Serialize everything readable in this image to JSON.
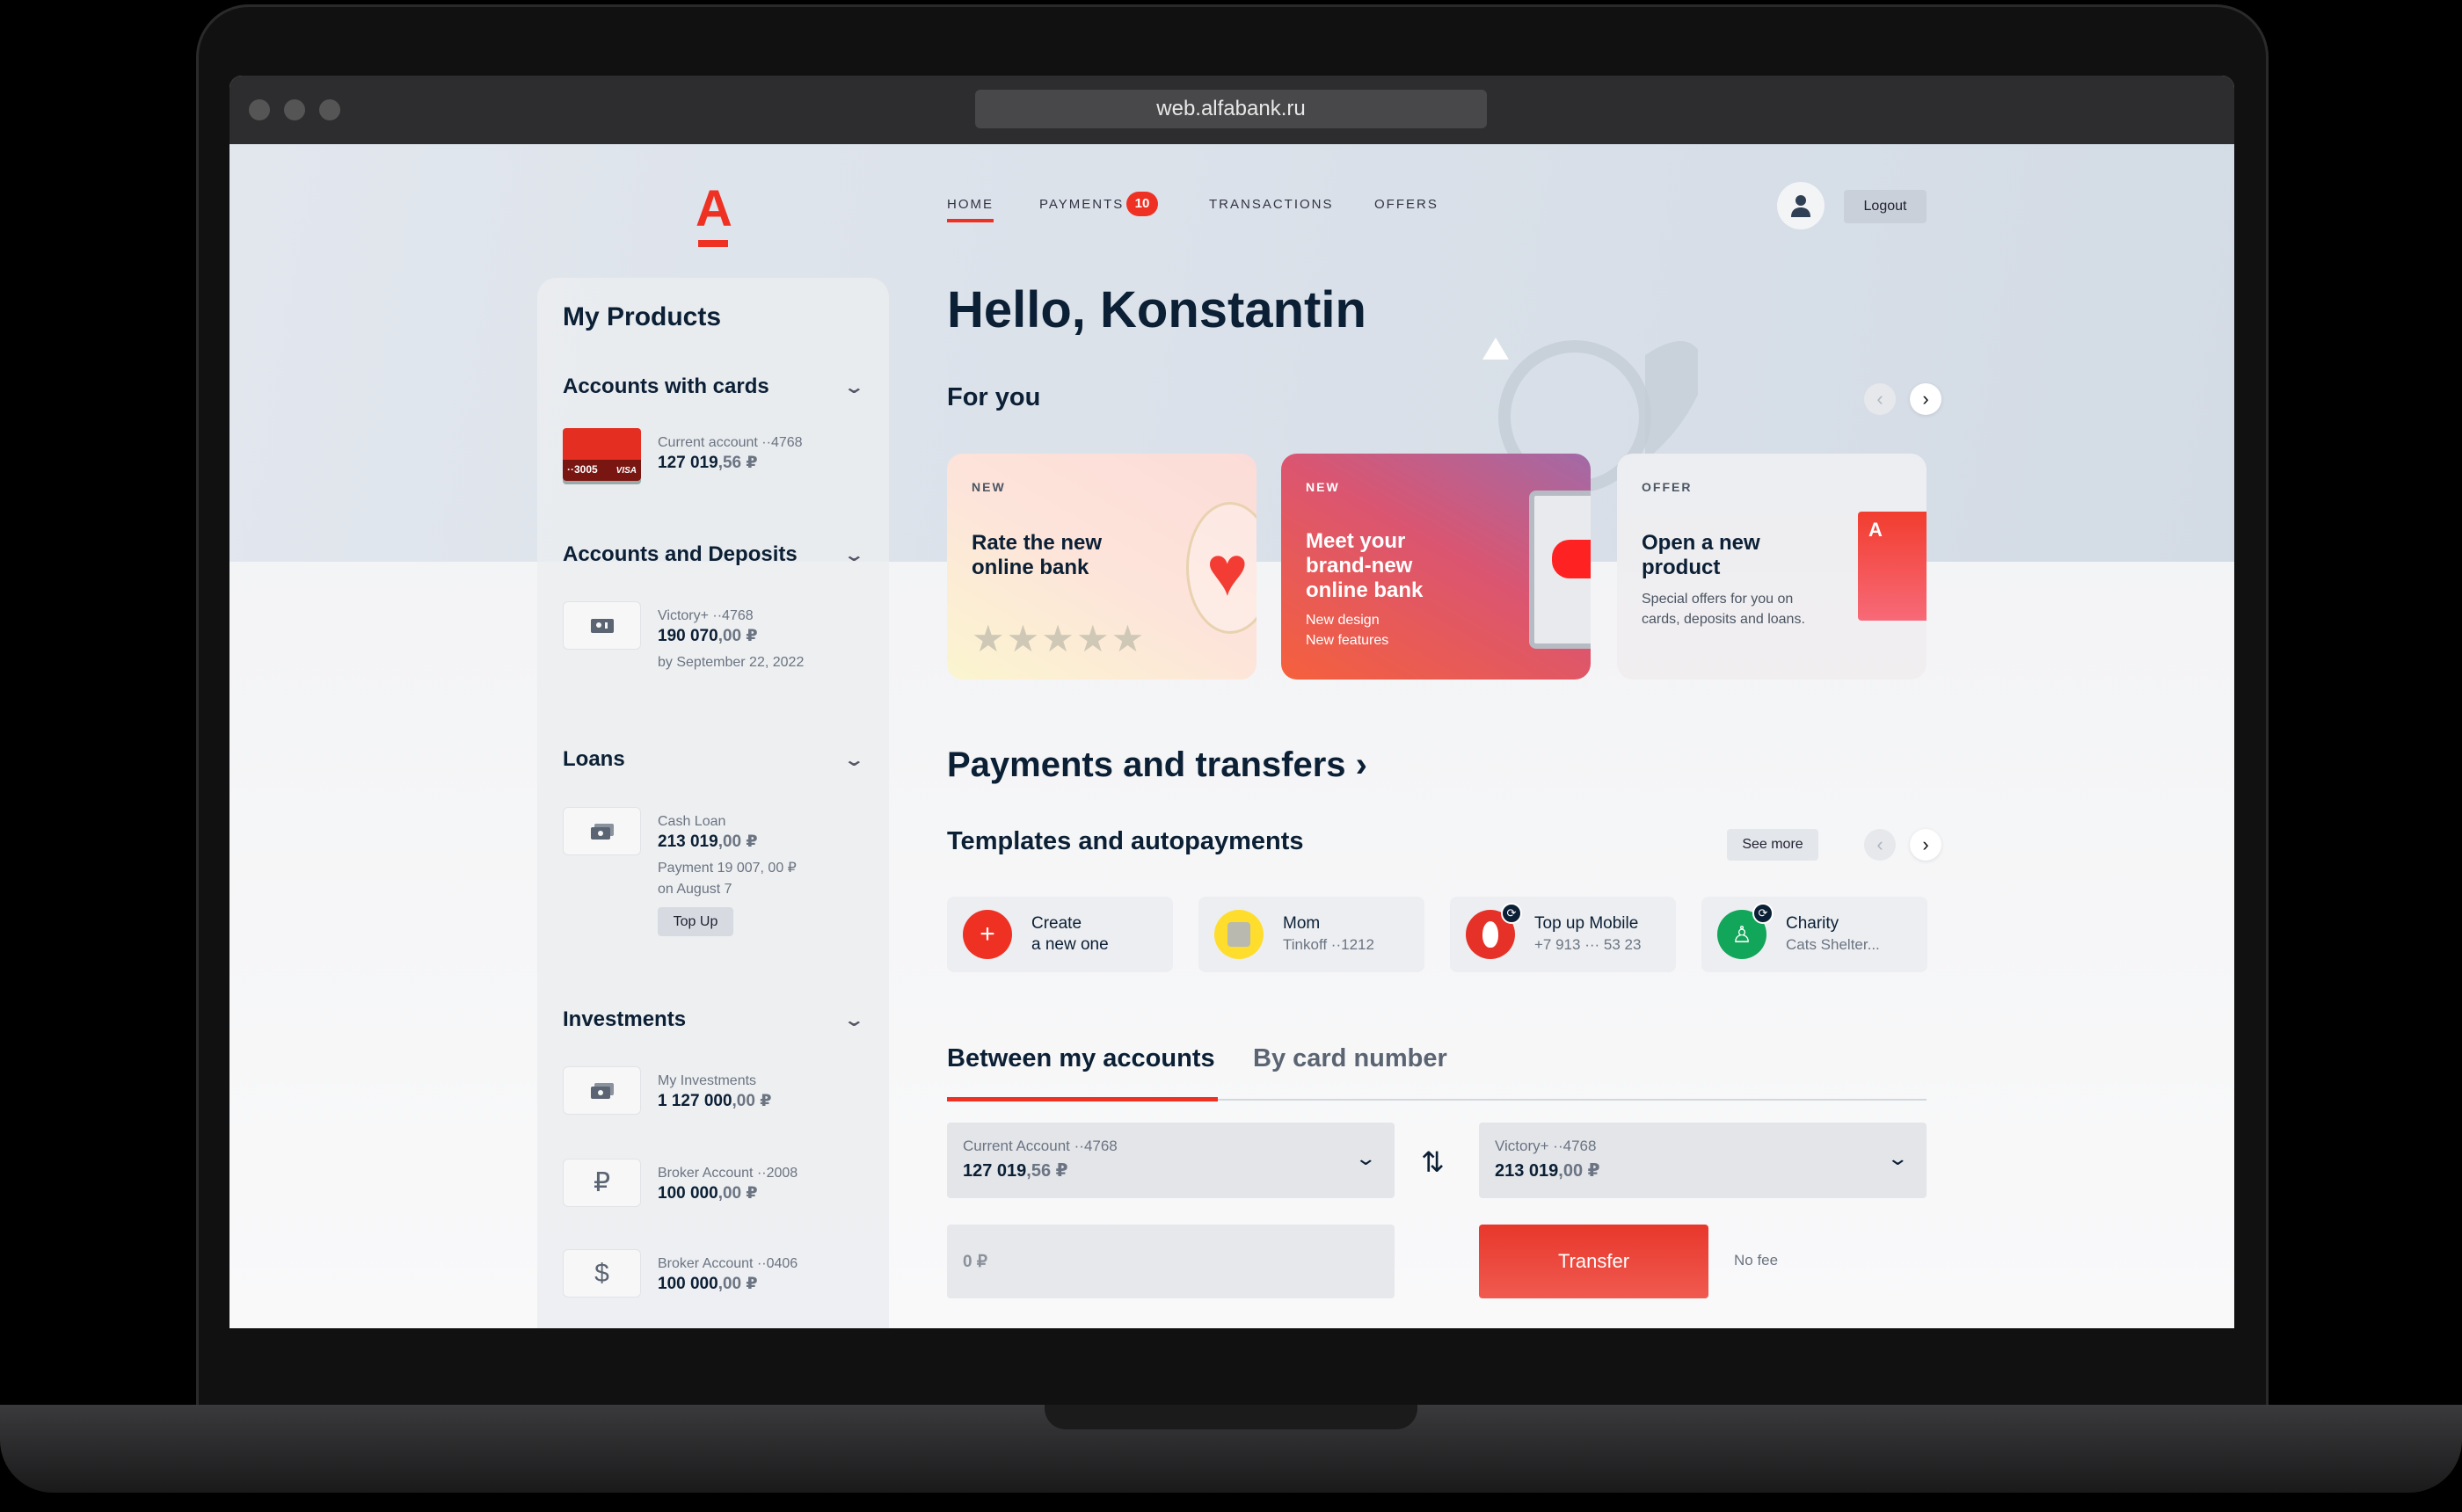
{
  "browser": {
    "url": "web.alfabank.ru"
  },
  "brand": {
    "logo_letter": "A",
    "accent": "#ef3124"
  },
  "nav": {
    "items": [
      {
        "label": "HOME",
        "active": true
      },
      {
        "label": "PAYMENTS",
        "badge": "10"
      },
      {
        "label": "TRANSACTIONS"
      },
      {
        "label": "OFFERS"
      }
    ],
    "logout": "Logout",
    "avatar_icon": "user-icon"
  },
  "sidebar": {
    "title": "My Products",
    "sections": [
      {
        "title": "Accounts with cards",
        "items": [
          {
            "card_number": "··3005",
            "card_brand": "VISA",
            "caption": "Current account ··4768",
            "amount_main": "127 019",
            "amount_dec": ",56 ₽"
          }
        ]
      },
      {
        "title": "Accounts and Deposits",
        "items": [
          {
            "icon": "safe-icon",
            "caption": "Victory+ ··4768",
            "amount_main": "190 070",
            "amount_dec": ",00 ₽",
            "note": "by September 22, 2022"
          }
        ]
      },
      {
        "title": "Loans",
        "items": [
          {
            "icon": "cash-icon",
            "caption": "Cash Loan",
            "amount_main": "213 019",
            "amount_dec": ",00 ₽",
            "note": "Payment 19 007, 00 ₽",
            "note2": "on August 7",
            "button": "Top Up"
          }
        ]
      },
      {
        "title": "Investments",
        "items": [
          {
            "icon": "cash-icon",
            "caption": "My Investments",
            "amount_main": "1 127 000",
            "amount_dec": ",00 ₽"
          },
          {
            "icon": "ruble-icon",
            "glyph": "₽",
            "caption": "Broker Account ··2008",
            "amount_main": "100 000",
            "amount_dec": ",00 ₽"
          },
          {
            "icon": "dollar-icon",
            "glyph": "$",
            "caption": "Broker Account ··0406",
            "amount_main": "100 000",
            "amount_dec": ",00 ₽"
          }
        ]
      }
    ]
  },
  "main": {
    "greeting": "Hello, Konstantin",
    "for_you": "For you",
    "promos": [
      {
        "tag": "NEW",
        "title": "Rate the new online bank"
      },
      {
        "tag": "NEW",
        "title": "Meet your brand-new online bank",
        "sub1": "New design",
        "sub2": "New features"
      },
      {
        "tag": "OFFER",
        "title": "Open a new product",
        "sub": "Special offers for you on cards, deposits and loans."
      }
    ],
    "payments_title": "Payments and transfers",
    "templates_title": "Templates and autopayments",
    "see_more": "See more",
    "templates": [
      {
        "name": "Create",
        "sub": "a new one",
        "color": "#ef3124"
      },
      {
        "name": "Mom",
        "sub": "Tinkoff ··1212",
        "color": "#ffdd2d"
      },
      {
        "name": "Top up Mobile",
        "sub": "+7 913 ··· 53 23",
        "color": "#e53127"
      },
      {
        "name": "Charity",
        "sub": "Cats Shelter...",
        "color": "#12a65a"
      }
    ],
    "tabs": [
      {
        "label": "Between my accounts",
        "active": true
      },
      {
        "label": "By card number"
      }
    ],
    "from": {
      "caption": "Current Account ··4768",
      "amount_main": "127 019",
      "amount_dec": ",56 ₽"
    },
    "to": {
      "caption": "Victory+ ··4768",
      "amount_main": "213 019",
      "amount_dec": ",00 ₽"
    },
    "amount_value": "0 ₽",
    "transfer": "Transfer",
    "fee": "No fee"
  }
}
